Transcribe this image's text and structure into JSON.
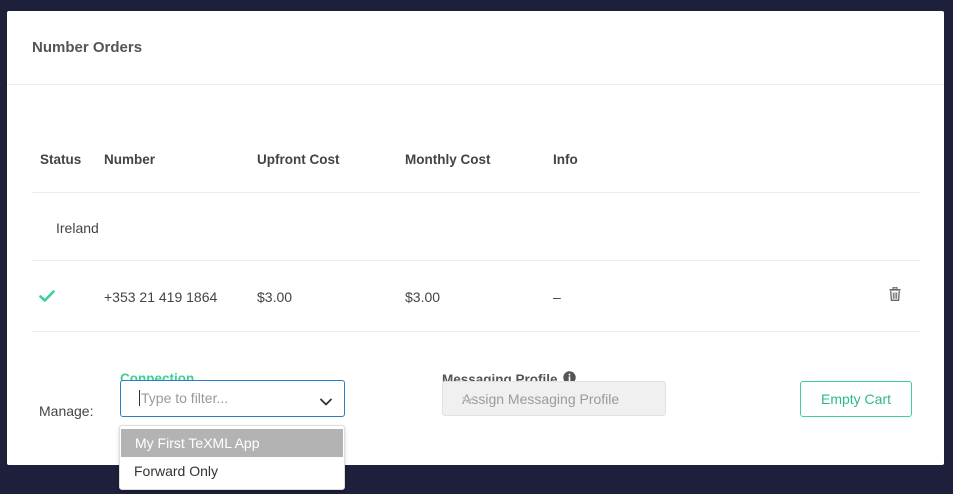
{
  "panel": {
    "title": "Number Orders"
  },
  "table": {
    "headers": [
      "Status",
      "Number",
      "Upfront Cost",
      "Monthly Cost",
      "Info"
    ],
    "country": "Ireland",
    "rows": [
      {
        "status_icon": "check-icon",
        "number": "+353 21 419 1864",
        "upfront": "$3.00",
        "monthly": "$3.00",
        "info": "–"
      }
    ]
  },
  "manage": {
    "label": "Manage:",
    "connection": {
      "label": "Connection",
      "placeholder": "Type to filter...",
      "options": [
        "My First TeXML App",
        "Forward Only"
      ],
      "highlighted_option": "My First TeXML App"
    },
    "messaging_profile": {
      "label": "Messaging Profile",
      "value": "Assign Messaging Profile"
    },
    "empty_cart_label": "Empty Cart"
  },
  "colors": {
    "background": "#1d1f3b",
    "accent": "#3ecf9b",
    "focus_border": "#2a7fc4"
  }
}
